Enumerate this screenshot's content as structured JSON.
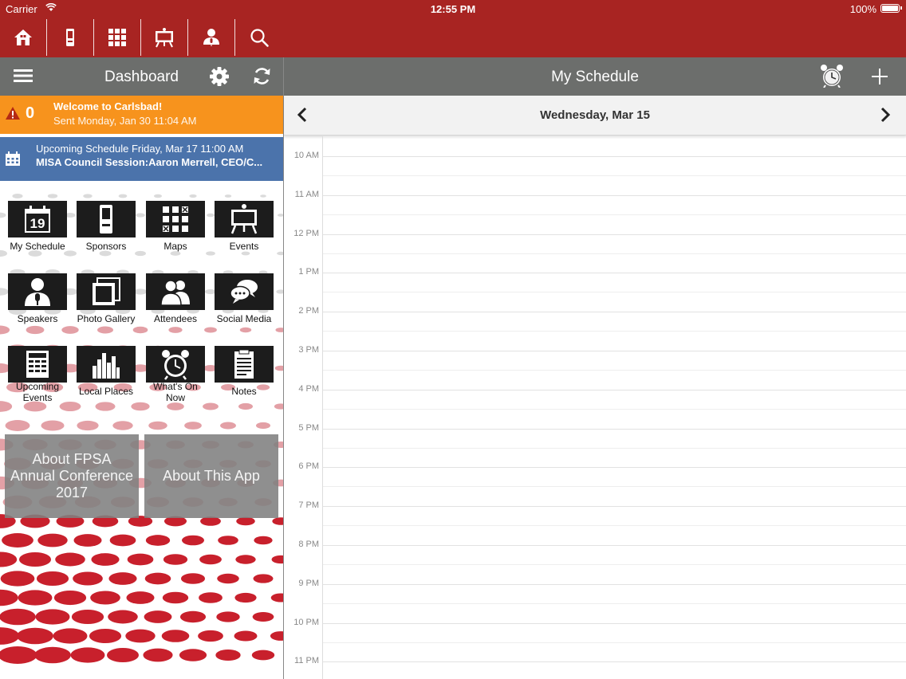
{
  "status_bar": {
    "carrier": "Carrier",
    "time": "12:55 PM",
    "battery": "100%"
  },
  "toolbar": {
    "icons": [
      "home-icon",
      "sponsors-icon",
      "maps-icon",
      "events-icon",
      "speakers-icon",
      "search-icon"
    ]
  },
  "left_panel": {
    "title": "Dashboard",
    "alert": {
      "count": "0",
      "title": "Welcome to Carlsbad!",
      "subtitle": "Sent Monday, Jan 30 11:04 AM"
    },
    "upcoming": {
      "line1": "Upcoming Schedule Friday, Mar 17 11:00 AM",
      "line2": "MISA Council Session:Aaron Merrell, CEO/C..."
    },
    "tiles": [
      {
        "label": "My Schedule",
        "icon": "calendar-icon"
      },
      {
        "label": "Sponsors",
        "icon": "sponsors-icon"
      },
      {
        "label": "Maps",
        "icon": "maps-icon"
      },
      {
        "label": "Events",
        "icon": "events-icon"
      },
      {
        "label": "Speakers",
        "icon": "speaker-icon"
      },
      {
        "label": "Photo Gallery",
        "icon": "photo-gallery-icon"
      },
      {
        "label": "Attendees",
        "icon": "attendees-icon"
      },
      {
        "label": "Social Media",
        "icon": "social-media-icon"
      },
      {
        "label": "Upcoming Events",
        "icon": "upcoming-events-icon"
      },
      {
        "label": "Local Places",
        "icon": "local-places-icon"
      },
      {
        "label": "What's On Now",
        "icon": "alarm-clock-icon"
      },
      {
        "label": "Notes",
        "icon": "notes-icon"
      }
    ],
    "buttons": {
      "about_conference": "About FPSA Annual Conference 2017",
      "about_app": "About This App"
    }
  },
  "right_panel": {
    "title": "My Schedule",
    "date": "Wednesday, Mar 15",
    "hours": [
      "10 AM",
      "11 AM",
      "12 PM",
      "1 PM",
      "2 PM",
      "3 PM",
      "4 PM",
      "5 PM",
      "6 PM",
      "7 PM",
      "8 PM",
      "9 PM",
      "10 PM",
      "11 PM"
    ]
  },
  "colors": {
    "brand_red": "#a82422",
    "header_gray": "#6c6e6c",
    "alert_orange": "#f7931d",
    "upcoming_blue": "#4b73ab"
  }
}
